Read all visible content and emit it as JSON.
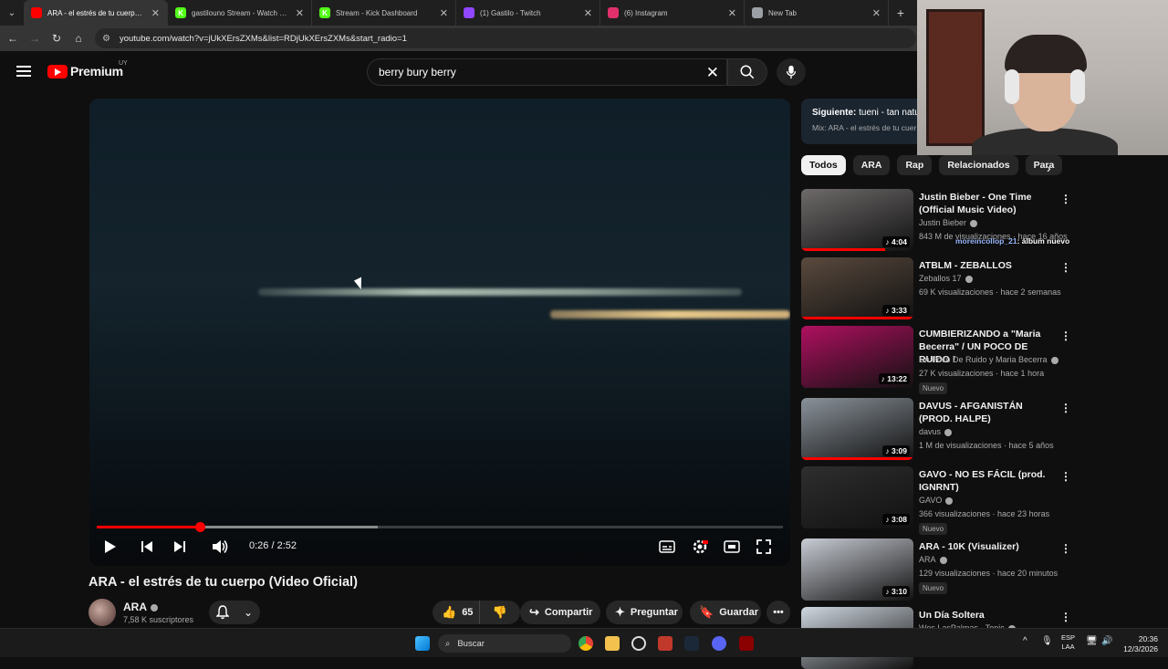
{
  "browser": {
    "tabs": [
      {
        "label": "ARA - el estrés de tu cuerpo (V",
        "color": "#ff0000",
        "glyph": ""
      },
      {
        "label": "gastilouno Stream - Watch Live",
        "color": "#53fc18",
        "glyph": "K"
      },
      {
        "label": "Stream - Kick Dashboard",
        "color": "#53fc18",
        "glyph": "K"
      },
      {
        "label": "(1) Gastilo - Twitch",
        "color": "#9146ff",
        "glyph": ""
      },
      {
        "label": "(6) Instagram",
        "color": "#e1306c",
        "glyph": ""
      },
      {
        "label": "New Tab",
        "color": "#9aa0a6",
        "glyph": ""
      }
    ],
    "url": "youtube.com/watch?v=jUkXErsZXMs&list=RDjUkXErsZXMs&start_radio=1"
  },
  "header": {
    "logo": "Premium",
    "country": "UY",
    "search_value": "berry bury berry"
  },
  "player": {
    "time": "0:26 / 2:52",
    "progress_fraction": 0.15,
    "buffered_fraction": 0.41
  },
  "video": {
    "title": "ARA - el estrés de tu cuerpo (Video Oficial)",
    "channel": "ARA",
    "subscribers": "7,58 K suscriptores",
    "likes": "65",
    "share": "Compartir",
    "ask": "Preguntar",
    "save": "Guardar"
  },
  "upnext": {
    "label": "Siguiente:",
    "title": "tueni - tan natu",
    "mix": "Mix: ARA - el estrés de tu cuer"
  },
  "chips": [
    "Todos",
    "ARA",
    "Rap",
    "Relacionados",
    "Para"
  ],
  "recs": [
    {
      "title": "Justin Bieber - One Time (Official Music Video)",
      "channel": "Justin Bieber",
      "meta": "843 M de visualizaciones · hace 16 años",
      "duration": "4:04",
      "badge": "",
      "progress": 0.75,
      "thumb": "#6e6a6a"
    },
    {
      "title": "ATBLM - ZEBALLOS",
      "channel": "Zeballos 17",
      "meta": "69 K visualizaciones · hace 2 semanas",
      "duration": "3:33",
      "badge": "",
      "progress": 1.0,
      "thumb": "#5a4a3e"
    },
    {
      "title": "CUMBIERIZANDO a \"Maria Becerra\" / UN POCO DE RUIDO !",
      "channel": "Un Poco De Ruido y Maria Becerra",
      "meta": "27 K visualizaciones · hace 1 hora",
      "duration": "13:22",
      "badge": "Nuevo",
      "progress": 0.0,
      "thumb": "#b01060"
    },
    {
      "title": "DAVUS - AFGANISTÁN (PROD. HALPE)",
      "channel": "davus",
      "meta": "1 M de visualizaciones · hace 5 años",
      "duration": "3:09",
      "badge": "",
      "progress": 1.0,
      "thumb": "#8a929a"
    },
    {
      "title": "GAVO - NO ES FÁCIL (prod. IGNRNT)",
      "channel": "GAVO",
      "meta": "366 visualizaciones · hace 23 horas",
      "duration": "3:08",
      "badge": "Nuevo",
      "progress": 0.0,
      "thumb": "#2e2e2e"
    },
    {
      "title": "ARA - 10K (Visualizer)",
      "channel": "ARA",
      "meta": "129 visualizaciones · hace 20 minutos",
      "duration": "3:10",
      "badge": "Nuevo",
      "progress": 0.0,
      "thumb": "#c8ccd4"
    },
    {
      "title": "Un Día Soltera",
      "channel": "Wos LasPalmas · Topic",
      "meta": "",
      "duration": "",
      "badge": "",
      "progress": 0.0,
      "thumb": "#cfd7e0"
    }
  ],
  "chat": {
    "user": "moreincollop_21",
    "message": ": álbum nuevo"
  },
  "taskbar": {
    "search": "Buscar",
    "lang1": "ESP",
    "lang2": "LAA",
    "time": "20:36",
    "date": "12/3/2026"
  }
}
